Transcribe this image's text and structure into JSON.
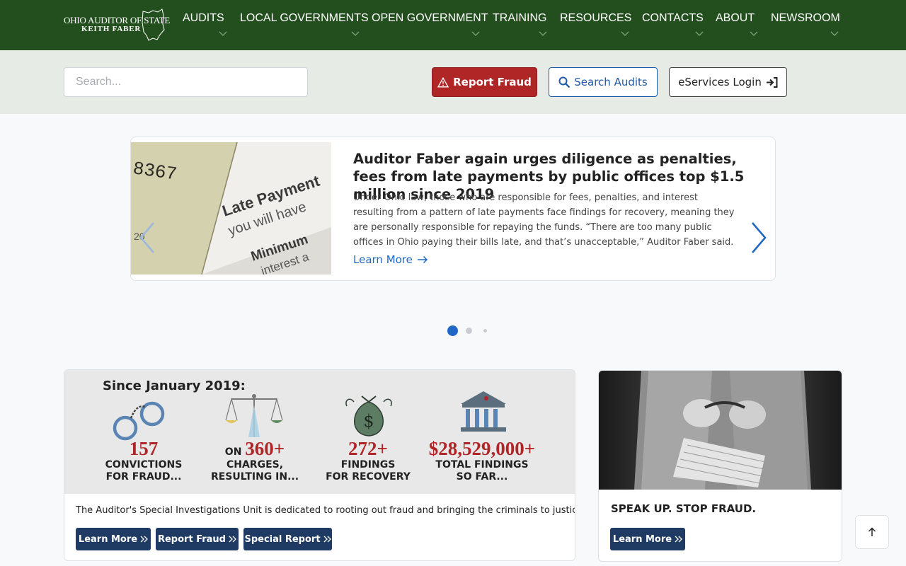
{
  "header": {
    "logo_line1": "OHIO AUDITOR OF STATE",
    "logo_line2": "KEITH FABER",
    "nav": [
      {
        "label": "AUDITS"
      },
      {
        "label": "LOCAL GOVERNMENTS"
      },
      {
        "label": "OPEN GOVERNMENT"
      },
      {
        "label": "TRAINING"
      },
      {
        "label": "RESOURCES"
      },
      {
        "label": "CONTACTS"
      },
      {
        "label": "ABOUT"
      },
      {
        "label": "NEWSROOM"
      }
    ]
  },
  "toolbar": {
    "search_placeholder": "Search...",
    "report_fraud": "Report Fraud",
    "search_audits": "Search Audits",
    "eservices": "eServices Login"
  },
  "slide": {
    "title": "Auditor Faber again urges diligence as penalties, fees from late payments by public offices top $1.5 million since 2019",
    "body": "Under Ohio law, those who are responsible for fees, penalties, and interest resulting from a pattern of late payments face findings for recovery, meaning they are personally responsible for repaying the funds. “There are too many public offices in Ohio paying their bills late, and that’s unacceptable,” Auditor Faber said.",
    "learn_more": "Learn More",
    "image_text": {
      "number": "8367",
      "t1": "Late Payment",
      "t2": "you will have",
      "t3": "Minimum",
      "t4": "interest a",
      "t5": "20"
    },
    "active_dot": 0,
    "dot_count": 3
  },
  "fraud_stats": {
    "heading": "Since January 2019:",
    "stats": [
      {
        "pre": "",
        "number": "157",
        "caption1": "CONVICTIONS",
        "caption2": "FOR FRAUD..."
      },
      {
        "pre": "ON ",
        "number": "360+",
        "caption1": "CHARGES,",
        "caption2": "RESULTING IN..."
      },
      {
        "pre": "",
        "number": "272+",
        "caption1": "FINDINGS",
        "caption2": "FOR RECOVERY"
      },
      {
        "pre": "",
        "number": "$28,529,000+",
        "caption1": "TOTAL FINDINGS",
        "caption2": "SO FAR..."
      }
    ],
    "description": "The Auditor's Special Investigations Unit is dedicated to rooting out fraud and bringing the criminals to justice.",
    "buttons": {
      "learn_more": "Learn More",
      "report_fraud": "Report Fraud",
      "special_report": "Special Report"
    }
  },
  "speak_up": {
    "title": "SPEAK UP. STOP FRAUD.",
    "learn_more": "Learn More"
  },
  "colors": {
    "nav_green": "#234f1e",
    "fraud_red": "#b02627",
    "link_blue": "#1f67c4",
    "navy": "#1f3b63"
  }
}
